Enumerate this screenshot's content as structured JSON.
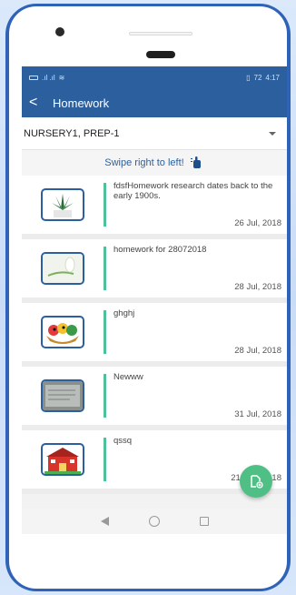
{
  "status_bar": {
    "time": "4:17",
    "battery": "72"
  },
  "app_bar": {
    "title": "Homework"
  },
  "class_selector": {
    "selected": "NURSERY1, PREP-1"
  },
  "hint": {
    "text": "Swipe right to left!"
  },
  "homework": [
    {
      "title": "fdsfHomework research dates back to the early 1900s.",
      "date": "26 Jul, 2018",
      "thumb": "plant-icon"
    },
    {
      "title": "homework for 28072018",
      "date": "28 Jul, 2018",
      "thumb": "flower-icon"
    },
    {
      "title": "ghghj",
      "date": "28 Jul, 2018",
      "thumb": "birds-icon"
    },
    {
      "title": "Newww",
      "date": "31 Jul, 2018",
      "thumb": "photo-icon"
    },
    {
      "title": "qssq",
      "date": "21 Nov, 2018",
      "thumb": "school-icon"
    }
  ],
  "colors": {
    "primary": "#2b5f9e",
    "accent": "#4fbf86",
    "frame": "#2f63b8"
  }
}
